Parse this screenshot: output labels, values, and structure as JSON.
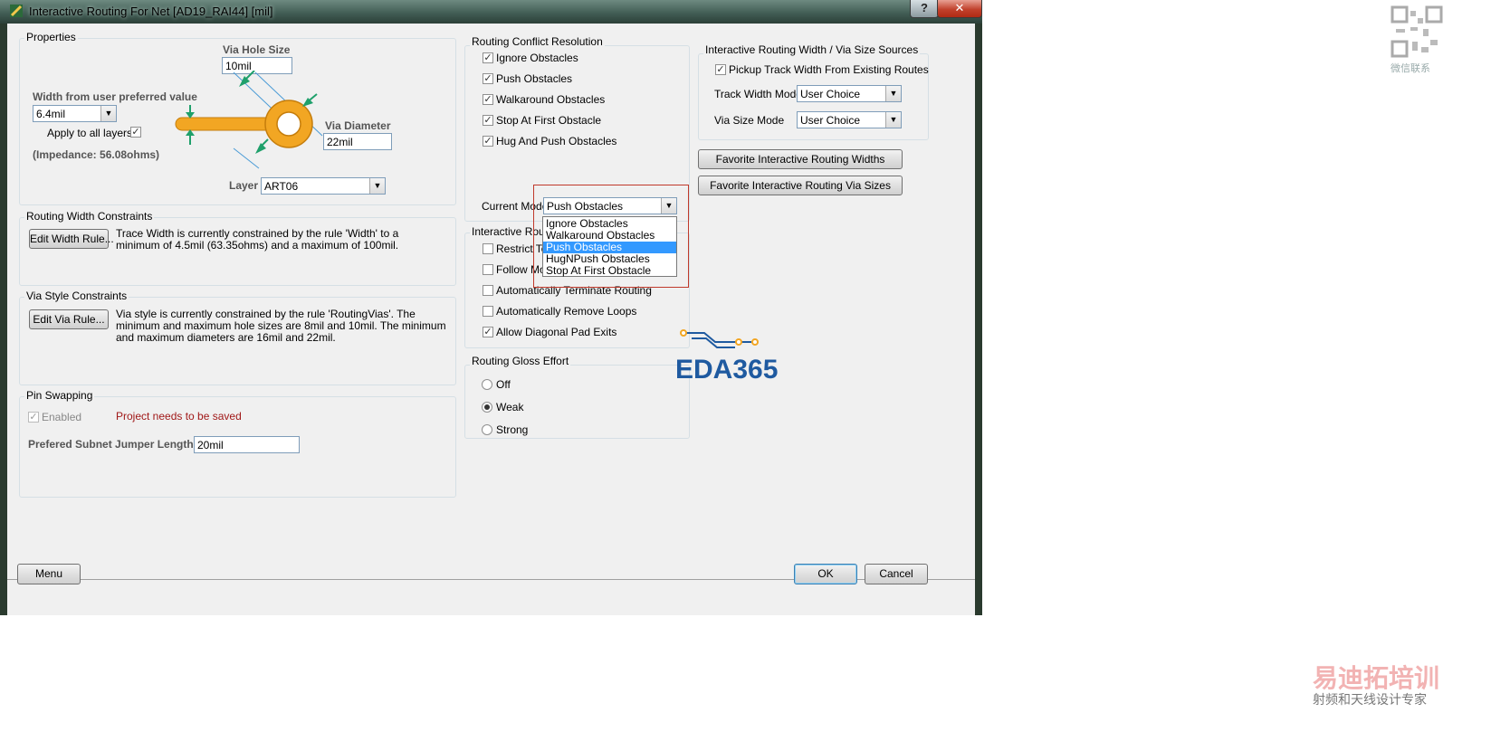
{
  "window": {
    "title": "Interactive Routing For Net [AD19_RAI44] [mil]",
    "help_label": "?",
    "close_label": "✕"
  },
  "properties": {
    "group_label": "Properties",
    "via_hole_size_label": "Via Hole Size",
    "via_hole_size_value": "10mil",
    "width_label": "Width from user preferred value",
    "width_value": "6.4mil",
    "apply_all_layers_label": "Apply to all layers",
    "apply_all_layers_checked": true,
    "impedance": "(Impedance: 56.08ohms)",
    "via_diameter_label": "Via Diameter",
    "via_diameter_value": "22mil",
    "layer_label": "Layer",
    "layer_value": "ART06"
  },
  "routing_width_constraints": {
    "group_label": "Routing Width Constraints",
    "button_label": "Edit Width Rule...",
    "text": "Trace Width is currently constrained by the rule 'Width' to a minimum of 4.5mil (63.35ohms) and a maximum of 100mil."
  },
  "via_style_constraints": {
    "group_label": "Via Style Constraints",
    "button_label": "Edit Via Rule...",
    "text": "Via style is currently constrained by the rule 'RoutingVias'. The minimum and maximum hole sizes are 8mil and 10mil. The minimum and maximum diameters are 16mil and 22mil."
  },
  "pin_swapping": {
    "group_label": "Pin Swapping",
    "enabled_label": "Enabled",
    "enabled_checked": true,
    "warning": "Project needs to be saved",
    "jumper_label": "Prefered Subnet Jumper Length",
    "jumper_value": "20mil"
  },
  "conflict_resolution": {
    "group_label": "Routing Conflict Resolution",
    "options": [
      {
        "label": "Ignore Obstacles",
        "checked": true
      },
      {
        "label": "Push Obstacles",
        "checked": true
      },
      {
        "label": "Walkaround Obstacles",
        "checked": true
      },
      {
        "label": "Stop At First Obstacle",
        "checked": true
      },
      {
        "label": "Hug And Push Obstacles",
        "checked": true
      }
    ],
    "current_mode_label": "Current Mode",
    "current_mode_value": "Push Obstacles",
    "dropdown_items": [
      "Ignore Obstacles",
      "Walkaround Obstacles",
      "Push Obstacles",
      "HugNPush Obstacles",
      "Stop At First Obstacle"
    ],
    "dropdown_selected": "Push Obstacles"
  },
  "interactive_routing_options": {
    "group_label": "Interactive Routi",
    "options": [
      {
        "label": "Restrict To",
        "checked": false
      },
      {
        "label": "Follow Mou",
        "checked": false
      },
      {
        "label": "Automatically Terminate Routing",
        "checked": false
      },
      {
        "label": "Automatically Remove Loops",
        "checked": false
      },
      {
        "label": "Allow Diagonal Pad Exits",
        "checked": true
      }
    ]
  },
  "gloss_effort": {
    "group_label": "Routing Gloss Effort",
    "options": [
      {
        "label": "Off",
        "selected": false
      },
      {
        "label": "Weak",
        "selected": true
      },
      {
        "label": "Strong",
        "selected": false
      }
    ]
  },
  "width_sources": {
    "group_label": "Interactive Routing Width / Via Size Sources",
    "pickup_label": "Pickup Track Width From Existing Routes",
    "pickup_checked": true,
    "track_width_mode_label": "Track Width Mode",
    "track_width_mode_value": "User Choice",
    "via_size_mode_label": "Via Size Mode",
    "via_size_mode_value": "User Choice",
    "fav_widths_button": "Favorite Interactive Routing Widths",
    "fav_vias_button": "Favorite Interactive Routing Via Sizes"
  },
  "footer": {
    "menu_button": "Menu",
    "ok_button": "OK",
    "cancel_button": "Cancel"
  },
  "watermarks": {
    "eda_logo": "EDA365",
    "qr_label": "微信联系",
    "brand_title": "易迪拓培训",
    "brand_subtitle": "射频和天线设计专家"
  },
  "colors": {
    "accent_selection": "#3399ff",
    "highlight_box": "#c0392b",
    "warning_text": "#a01818",
    "trace_orange": "#f2a623"
  }
}
